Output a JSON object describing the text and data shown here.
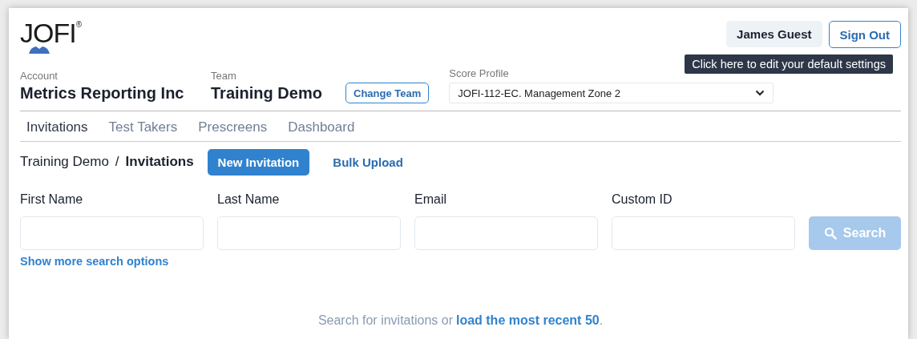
{
  "logo": {
    "text": "JOFI",
    "mark": "®"
  },
  "user": {
    "name": "James Guest",
    "sign_out": "Sign Out",
    "tooltip": "Click here to edit your default settings"
  },
  "account": {
    "label": "Account",
    "value": "Metrics Reporting Inc"
  },
  "team": {
    "label": "Team",
    "value": "Training Demo",
    "button": "Change Team"
  },
  "score_profile": {
    "label": "Score Profile",
    "value": "JOFI-112-EC. Management Zone 2"
  },
  "tabs": [
    {
      "label": "Invitations",
      "selected": true
    },
    {
      "label": "Test Takers",
      "selected": false
    },
    {
      "label": "Prescreens",
      "selected": false
    },
    {
      "label": "Dashboard",
      "selected": false
    }
  ],
  "breadcrumb": {
    "parent": "Training Demo",
    "separator": "/",
    "current": "Invitations"
  },
  "actions": {
    "new": "New Invitation",
    "bulk": "Bulk Upload"
  },
  "fields": [
    {
      "label": "First Name"
    },
    {
      "label": "Last Name"
    },
    {
      "label": "Email"
    },
    {
      "label": "Custom ID"
    }
  ],
  "search_button": {
    "label": "Search",
    "disabled": true
  },
  "more_options": "Show more search options",
  "empty": {
    "text": "Search for invitations or",
    "link": "load the most recent 50",
    "end": "."
  }
}
